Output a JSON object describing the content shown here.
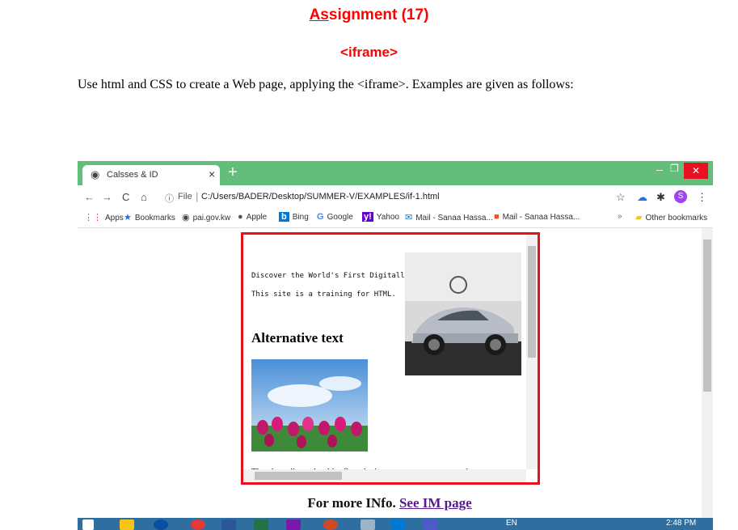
{
  "document": {
    "title_underlined": "As",
    "title_rest": "signment (17)",
    "subtitle": "<iframe>",
    "instruction": "Use html and CSS to create a Web page, applying the <iframe>. Examples are given as follows:"
  },
  "browser": {
    "tab_title": "Calsses & ID",
    "tab_close": "×",
    "new_tab": "+",
    "win_min": "–",
    "win_max": "❐",
    "win_close": "✕",
    "nav": {
      "back": "←",
      "forward": "→",
      "reload": "C",
      "home": "⌂"
    },
    "address": {
      "info_icon": "ⓘ",
      "scheme_label": "File",
      "sep": "|",
      "url": "C:/Users/BADER/Desktop/SUMMER-V/EXAMPLES/if-1.html"
    },
    "toolbar_icons": {
      "star": "☆",
      "extension": "✱",
      "menu": "⋮"
    },
    "profile_initial": "S",
    "bookmarks": [
      {
        "label": "Apps",
        "icon": "apps-grid-icon",
        "glyph": "⋮⋮"
      },
      {
        "label": "Bookmarks",
        "icon": "star-icon",
        "glyph": "★"
      },
      {
        "label": "pai.gov.kw",
        "icon": "globe-icon",
        "glyph": "◉"
      },
      {
        "label": "Apple",
        "icon": "apple-icon",
        "glyph": "●"
      },
      {
        "label": "Bing",
        "icon": "bing-icon",
        "glyph": "b"
      },
      {
        "label": "Google",
        "icon": "google-icon",
        "glyph": "G"
      },
      {
        "label": "Yahoo",
        "icon": "yahoo-icon",
        "glyph": "y!"
      },
      {
        "label": "Mail - Sanaa Hassa...",
        "icon": "outlook-icon",
        "glyph": "✉"
      },
      {
        "label": "Mail - Sanaa Hassa...",
        "icon": "microsoft-icon",
        "glyph": "■"
      }
    ],
    "bookmarks_overflow": "»",
    "other_bookmarks": "Other bookmarks"
  },
  "iframe": {
    "line1": "Discover the World's First Digitally Adaptive Handling System. Lear",
    "line2": "This site is a training for HTML.",
    "heading": "Alternative text",
    "alt_line": "The alt attribute should reflect the image content, so users who cannot"
  },
  "footer": {
    "more_info_text": "For more INfo.",
    "link_text": "See IM page"
  },
  "taskbar": {
    "time": "2:48 PM",
    "lang": "EN"
  },
  "colors": {
    "title_red": "#ff0000",
    "tab_green": "#63be7b",
    "iframe_border": "#e8101b",
    "link_purple": "#551a8b"
  }
}
